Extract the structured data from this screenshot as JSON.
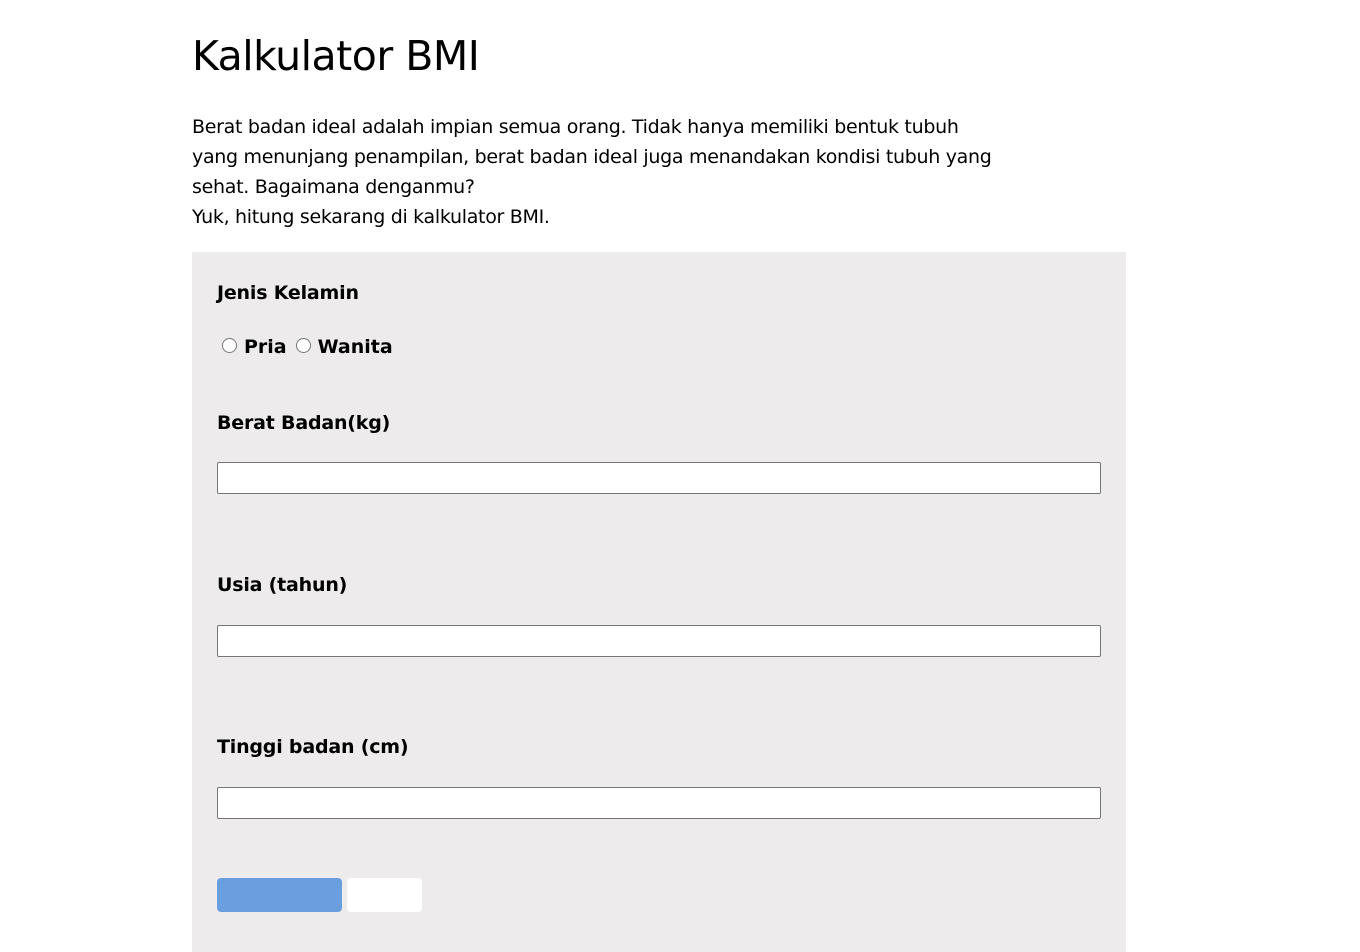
{
  "page": {
    "title": "Kalkulator BMI",
    "intro_lines": [
      "Berat badan ideal adalah impian semua orang. Tidak hanya memiliki bentuk tubuh",
      "yang menunjang penampilan, berat badan ideal juga menandakan kondisi tubuh yang",
      "sehat. Bagaimana denganmu?",
      "Yuk, hitung sekarang di kalkulator BMI."
    ]
  },
  "form": {
    "gender": {
      "label": "Jenis Kelamin",
      "options": [
        "Pria",
        "Wanita"
      ],
      "selected": ""
    },
    "weight": {
      "label": "Berat Badan(kg)",
      "value": "",
      "placeholder": ""
    },
    "age": {
      "label": "Usia (tahun)",
      "value": "",
      "placeholder": ""
    },
    "height": {
      "label": "Tinggi badan (cm)",
      "value": "",
      "placeholder": ""
    },
    "buttons": {
      "primary_label": "",
      "secondary_label": ""
    }
  },
  "colors": {
    "panel_background": "#edebec",
    "primary_button": "#6a9fdf",
    "text": "#000000"
  }
}
